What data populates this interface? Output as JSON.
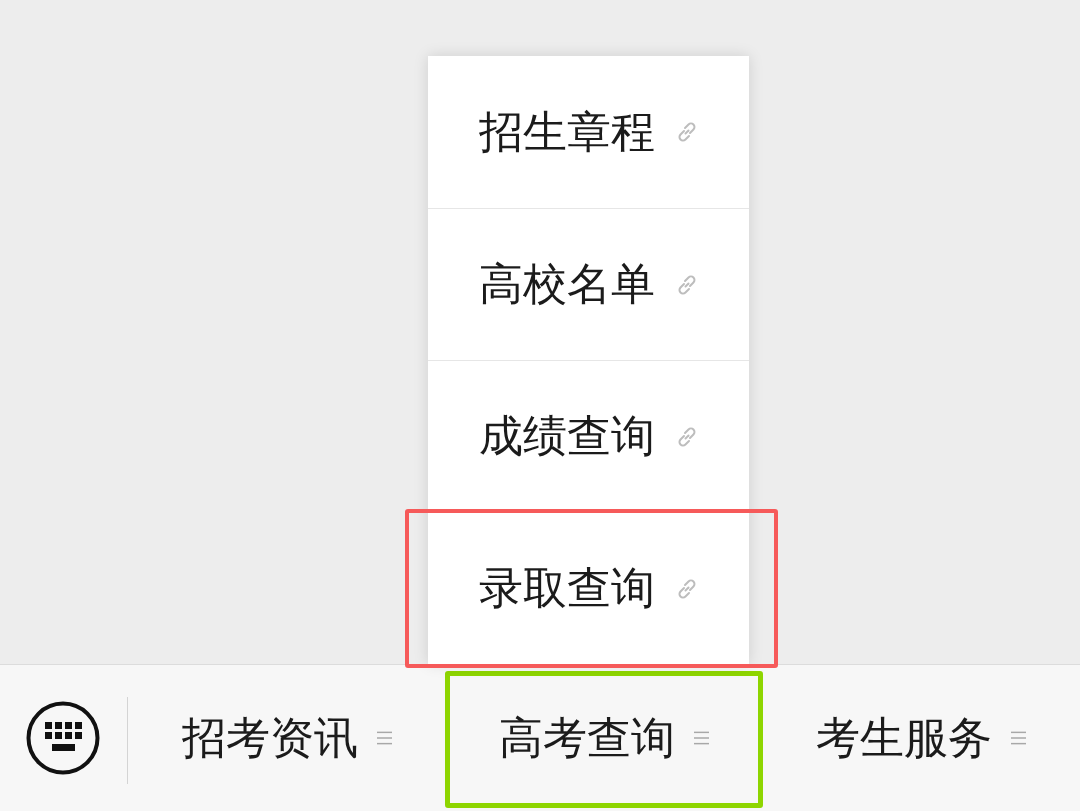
{
  "bottom_menu": {
    "tabs": [
      {
        "label": "招考资讯",
        "highlighted": false
      },
      {
        "label": "高考查询",
        "highlighted": true,
        "submenu": [
          {
            "label": "招生章程",
            "highlighted": false
          },
          {
            "label": "高校名单",
            "highlighted": false
          },
          {
            "label": "成绩查询",
            "highlighted": false
          },
          {
            "label": "录取查询",
            "highlighted": true
          }
        ]
      },
      {
        "label": "考生服务",
        "highlighted": false
      }
    ]
  }
}
